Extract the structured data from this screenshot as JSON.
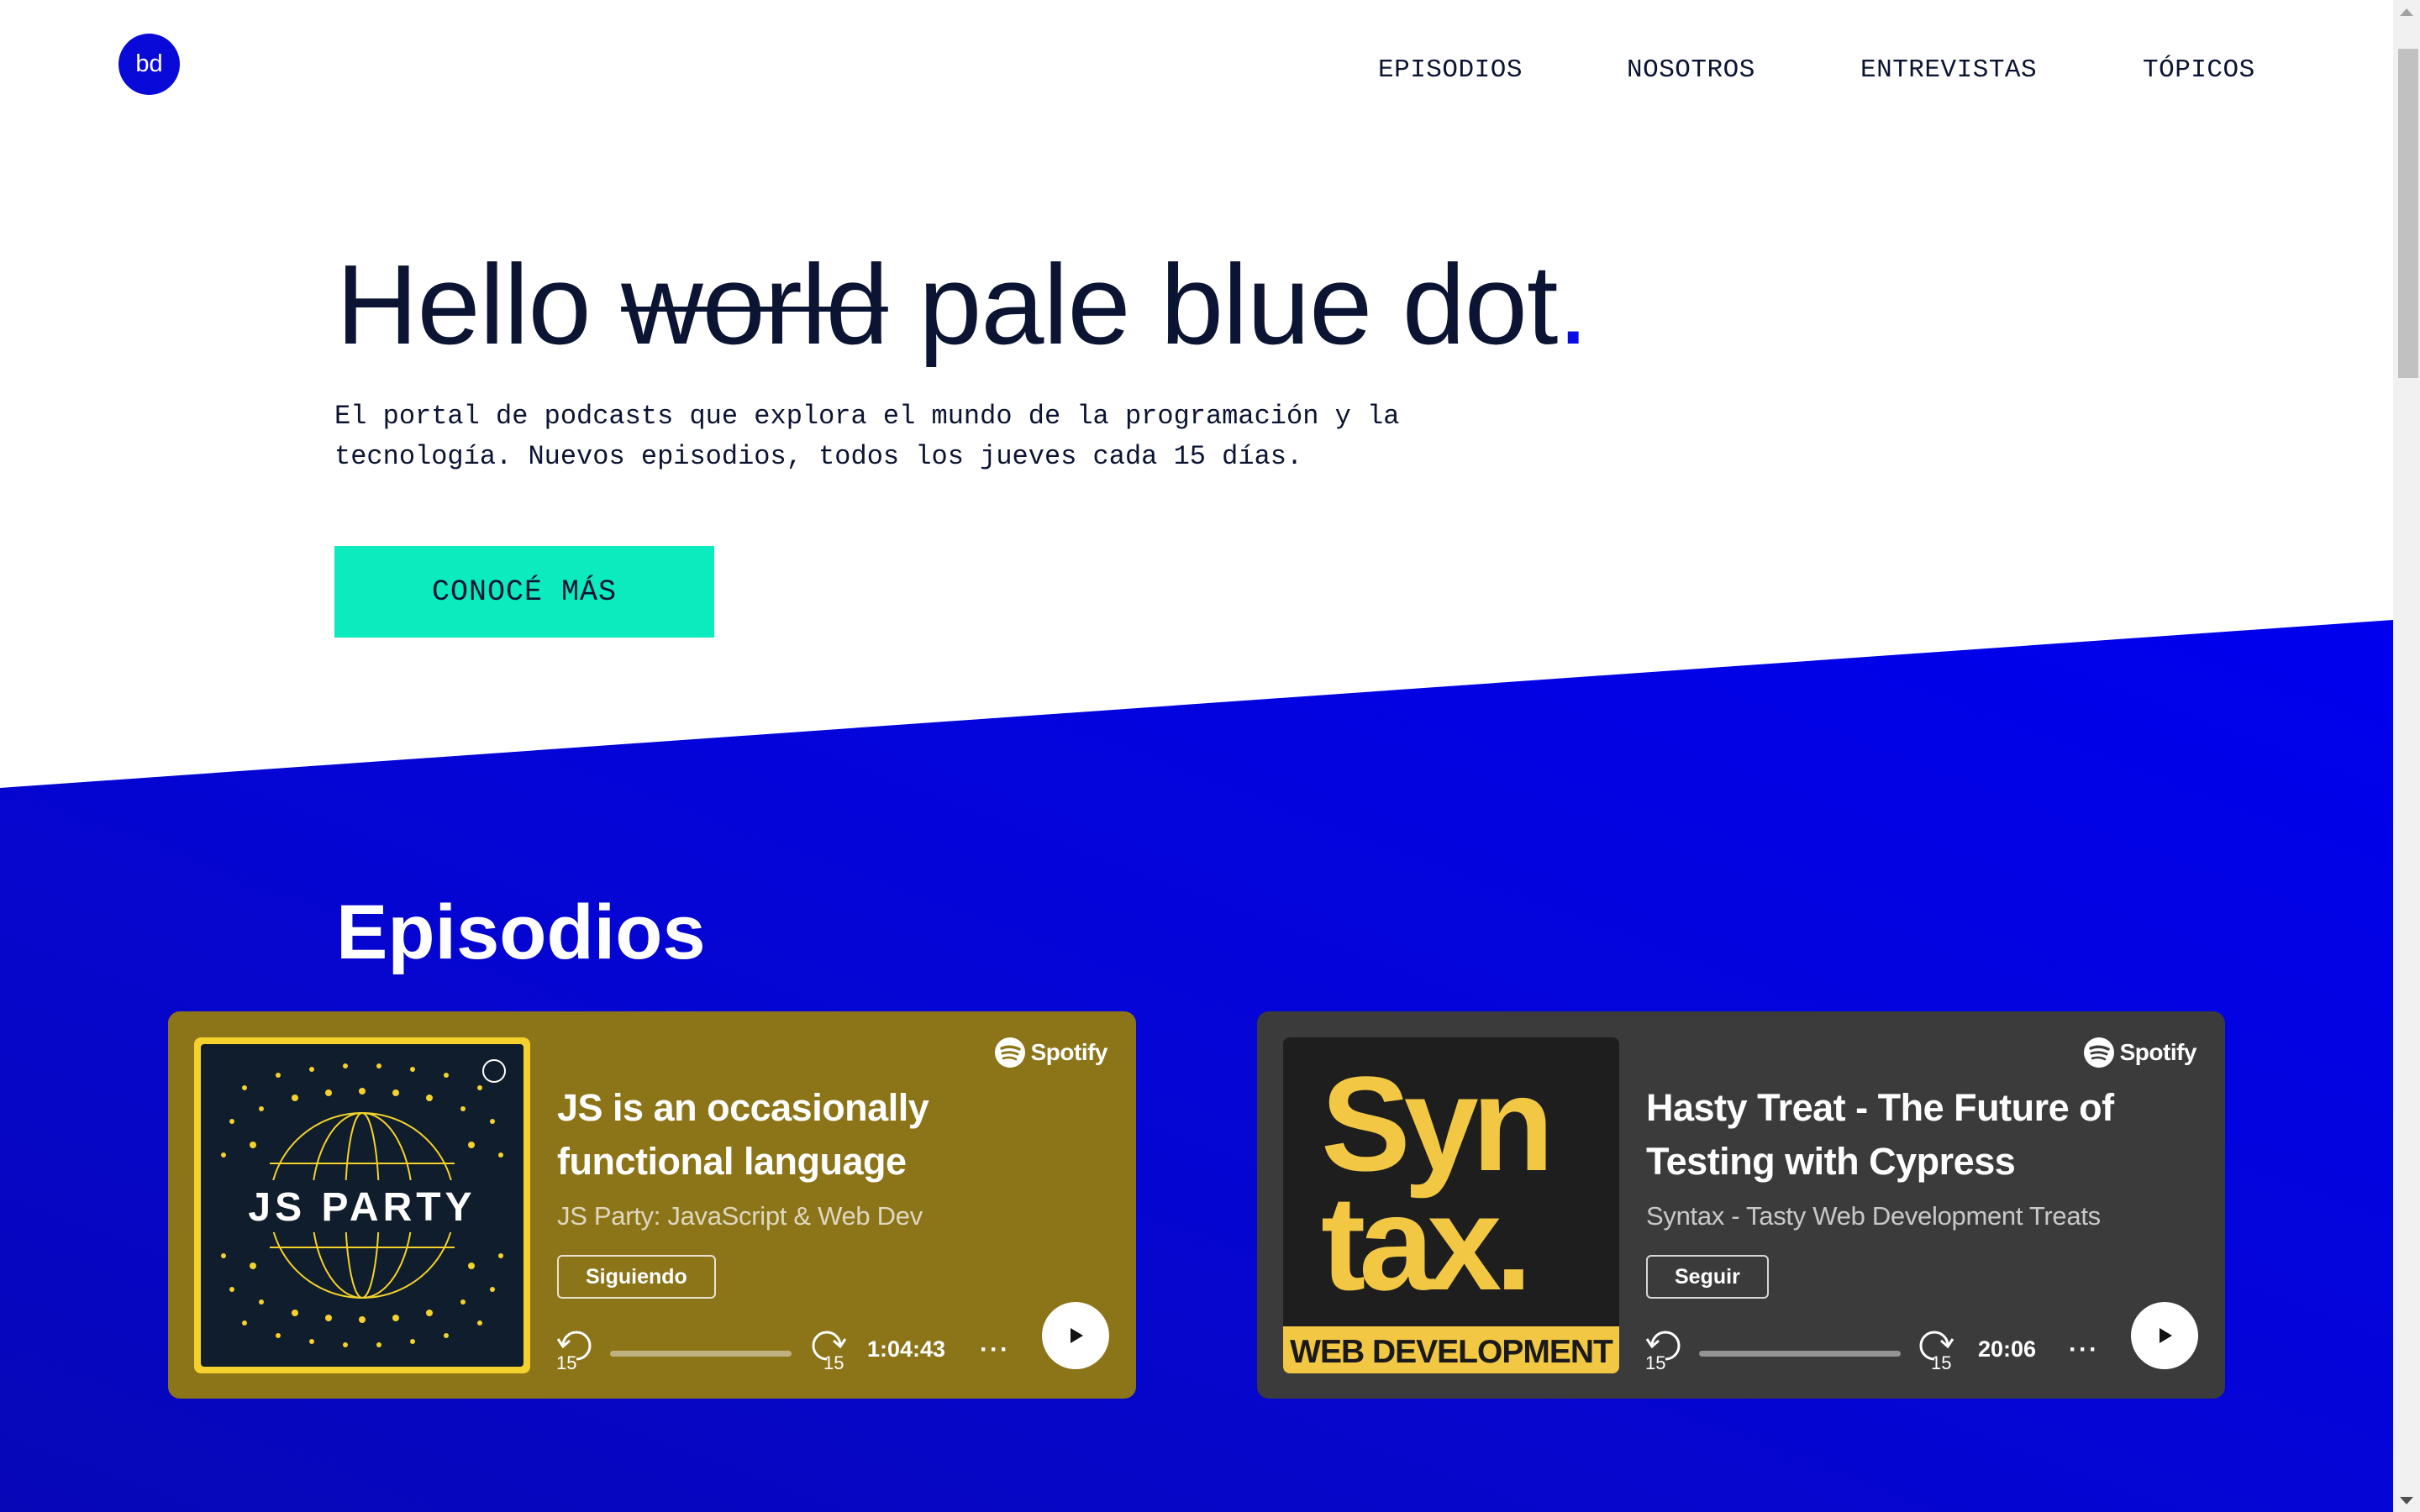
{
  "header": {
    "logo_text": "bd",
    "nav": [
      "EPISODIOS",
      "NOSOTROS",
      "ENTREVISTAS",
      "TÓPICOS"
    ]
  },
  "hero": {
    "title_start": "Hello ",
    "title_struck": "world",
    "title_end": " pale blue dot",
    "title_dot": ".",
    "description": "El portal de podcasts que explora el mundo de la programación y la tecnología. Nuevos episodios, todos los jueves cada 15 días.",
    "cta_label": "CONOCÉ MÁS"
  },
  "episodes": {
    "section_title": "Episodios",
    "cards": [
      {
        "brand": "Spotify",
        "cover_text": "JS PARTY",
        "title": "JS is an occasionally functional language",
        "show": "JS Party: JavaScript & Web Dev",
        "follow_label": "Siguiendo",
        "skip_back": "15",
        "skip_forward": "15",
        "duration": "1:04:43",
        "more": "···",
        "bg_color": "#8c7418"
      },
      {
        "brand": "Spotify",
        "cover_text_1": "Syn",
        "cover_text_2": "tax.",
        "cover_banner": "WEB DEVELOPMENT",
        "title": "Hasty Treat - The Future of Testing with Cypress",
        "show": "Syntax - Tasty Web Development Treats",
        "follow_label": "Seguir",
        "skip_back": "15",
        "skip_forward": "15",
        "duration": "20:06",
        "more": "···",
        "bg_color": "#3b3b3b"
      }
    ]
  },
  "colors": {
    "brand_blue": "#0a0ad8",
    "cta_green": "#0cebbd",
    "text_dark": "#0c1433"
  }
}
